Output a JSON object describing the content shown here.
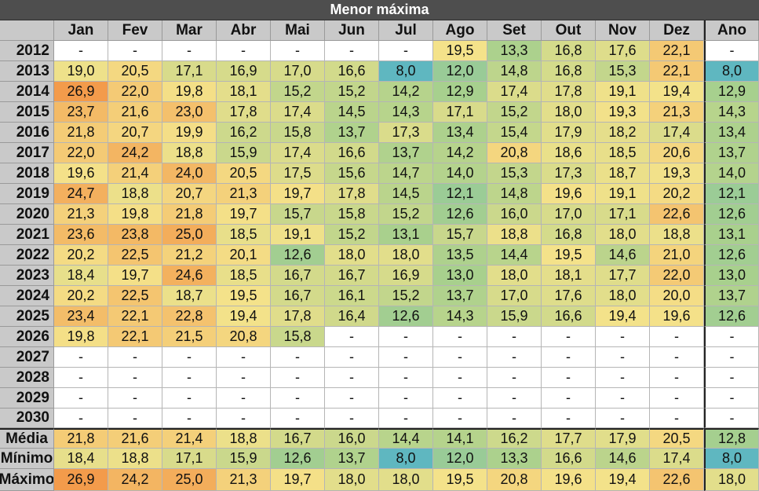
{
  "title": "Menor máxima",
  "months": [
    "Jan",
    "Fev",
    "Mar",
    "Abr",
    "Mai",
    "Jun",
    "Jul",
    "Ago",
    "Set",
    "Out",
    "Nov",
    "Dez",
    "Ano"
  ],
  "rows": [
    {
      "year": "2012",
      "values": [
        "-",
        "-",
        "-",
        "-",
        "-",
        "-",
        "-",
        "19,5",
        "13,3",
        "16,8",
        "17,6",
        "22,1",
        "-"
      ]
    },
    {
      "year": "2013",
      "values": [
        "19,0",
        "20,5",
        "17,1",
        "16,9",
        "17,0",
        "16,6",
        "8,0",
        "12,0",
        "14,8",
        "16,8",
        "15,3",
        "22,1",
        "8,0"
      ]
    },
    {
      "year": "2014",
      "values": [
        "26,9",
        "22,0",
        "19,8",
        "18,1",
        "15,2",
        "15,2",
        "14,2",
        "12,9",
        "17,4",
        "17,8",
        "19,1",
        "19,4",
        "12,9"
      ]
    },
    {
      "year": "2015",
      "values": [
        "23,7",
        "21,6",
        "23,0",
        "17,8",
        "17,4",
        "14,5",
        "14,3",
        "17,1",
        "15,2",
        "18,0",
        "19,3",
        "21,3",
        "14,3"
      ]
    },
    {
      "year": "2016",
      "values": [
        "21,8",
        "20,7",
        "19,9",
        "16,2",
        "15,8",
        "13,7",
        "17,3",
        "13,4",
        "15,4",
        "17,9",
        "18,2",
        "17,4",
        "13,4"
      ]
    },
    {
      "year": "2017",
      "values": [
        "22,0",
        "24,2",
        "18,8",
        "15,9",
        "17,4",
        "16,6",
        "13,7",
        "14,2",
        "20,8",
        "18,6",
        "18,5",
        "20,6",
        "13,7"
      ]
    },
    {
      "year": "2018",
      "values": [
        "19,6",
        "21,4",
        "24,0",
        "20,5",
        "17,5",
        "15,6",
        "14,7",
        "14,0",
        "15,3",
        "17,3",
        "18,7",
        "19,3",
        "14,0"
      ]
    },
    {
      "year": "2019",
      "values": [
        "24,7",
        "18,8",
        "20,7",
        "21,3",
        "19,7",
        "17,8",
        "14,5",
        "12,1",
        "14,8",
        "19,6",
        "19,1",
        "20,2",
        "12,1"
      ]
    },
    {
      "year": "2020",
      "values": [
        "21,3",
        "19,8",
        "21,8",
        "19,7",
        "15,7",
        "15,8",
        "15,2",
        "12,6",
        "16,0",
        "17,0",
        "17,1",
        "22,6",
        "12,6"
      ]
    },
    {
      "year": "2021",
      "values": [
        "23,6",
        "23,8",
        "25,0",
        "18,5",
        "19,1",
        "15,2",
        "13,1",
        "15,7",
        "18,8",
        "16,8",
        "18,0",
        "18,8",
        "13,1"
      ]
    },
    {
      "year": "2022",
      "values": [
        "20,2",
        "22,5",
        "21,2",
        "20,1",
        "12,6",
        "18,0",
        "18,0",
        "13,5",
        "14,4",
        "19,5",
        "14,6",
        "21,0",
        "12,6"
      ]
    },
    {
      "year": "2023",
      "values": [
        "18,4",
        "19,7",
        "24,6",
        "18,5",
        "16,7",
        "16,7",
        "16,9",
        "13,0",
        "18,0",
        "18,1",
        "17,7",
        "22,0",
        "13,0"
      ]
    },
    {
      "year": "2024",
      "values": [
        "20,2",
        "22,5",
        "18,7",
        "19,5",
        "16,7",
        "16,1",
        "15,2",
        "13,7",
        "17,0",
        "17,6",
        "18,0",
        "20,0",
        "13,7"
      ]
    },
    {
      "year": "2025",
      "values": [
        "23,4",
        "22,1",
        "22,8",
        "19,4",
        "17,8",
        "16,4",
        "12,6",
        "14,3",
        "15,9",
        "16,6",
        "19,4",
        "19,6",
        "12,6"
      ]
    },
    {
      "year": "2026",
      "values": [
        "19,8",
        "22,1",
        "21,5",
        "20,8",
        "15,8",
        "-",
        "-",
        "-",
        "-",
        "-",
        "-",
        "-",
        "-"
      ]
    },
    {
      "year": "2027",
      "values": [
        "-",
        "-",
        "-",
        "-",
        "-",
        "-",
        "-",
        "-",
        "-",
        "-",
        "-",
        "-",
        "-"
      ]
    },
    {
      "year": "2028",
      "values": [
        "-",
        "-",
        "-",
        "-",
        "-",
        "-",
        "-",
        "-",
        "-",
        "-",
        "-",
        "-",
        "-"
      ]
    },
    {
      "year": "2029",
      "values": [
        "-",
        "-",
        "-",
        "-",
        "-",
        "-",
        "-",
        "-",
        "-",
        "-",
        "-",
        "-",
        "-"
      ]
    },
    {
      "year": "2030",
      "values": [
        "-",
        "-",
        "-",
        "-",
        "-",
        "-",
        "-",
        "-",
        "-",
        "-",
        "-",
        "-",
        "-"
      ]
    }
  ],
  "summary": [
    {
      "label": "Média",
      "values": [
        "21,8",
        "21,6",
        "21,4",
        "18,8",
        "16,7",
        "16,0",
        "14,4",
        "14,1",
        "16,2",
        "17,7",
        "17,9",
        "20,5",
        "12,8"
      ]
    },
    {
      "label": "Mínimo",
      "values": [
        "18,4",
        "18,8",
        "17,1",
        "15,9",
        "12,6",
        "13,7",
        "8,0",
        "12,0",
        "13,3",
        "16,6",
        "14,6",
        "17,4",
        "8,0"
      ]
    },
    {
      "label": "Máximo",
      "values": [
        "26,9",
        "24,2",
        "25,0",
        "21,3",
        "19,7",
        "18,0",
        "18,0",
        "19,5",
        "20,8",
        "19,6",
        "19,4",
        "22,6",
        "18,0"
      ]
    }
  ],
  "colors": {
    "title_bg": "#4e4e4e",
    "header_bg": "#c9c9c9",
    "empty_cell": "#ffffff",
    "scale_low": "#5fb7c0",
    "scale_mid_green": "#a8d08d",
    "scale_mid": "#f4e28a",
    "scale_high": "#f39a4a"
  }
}
